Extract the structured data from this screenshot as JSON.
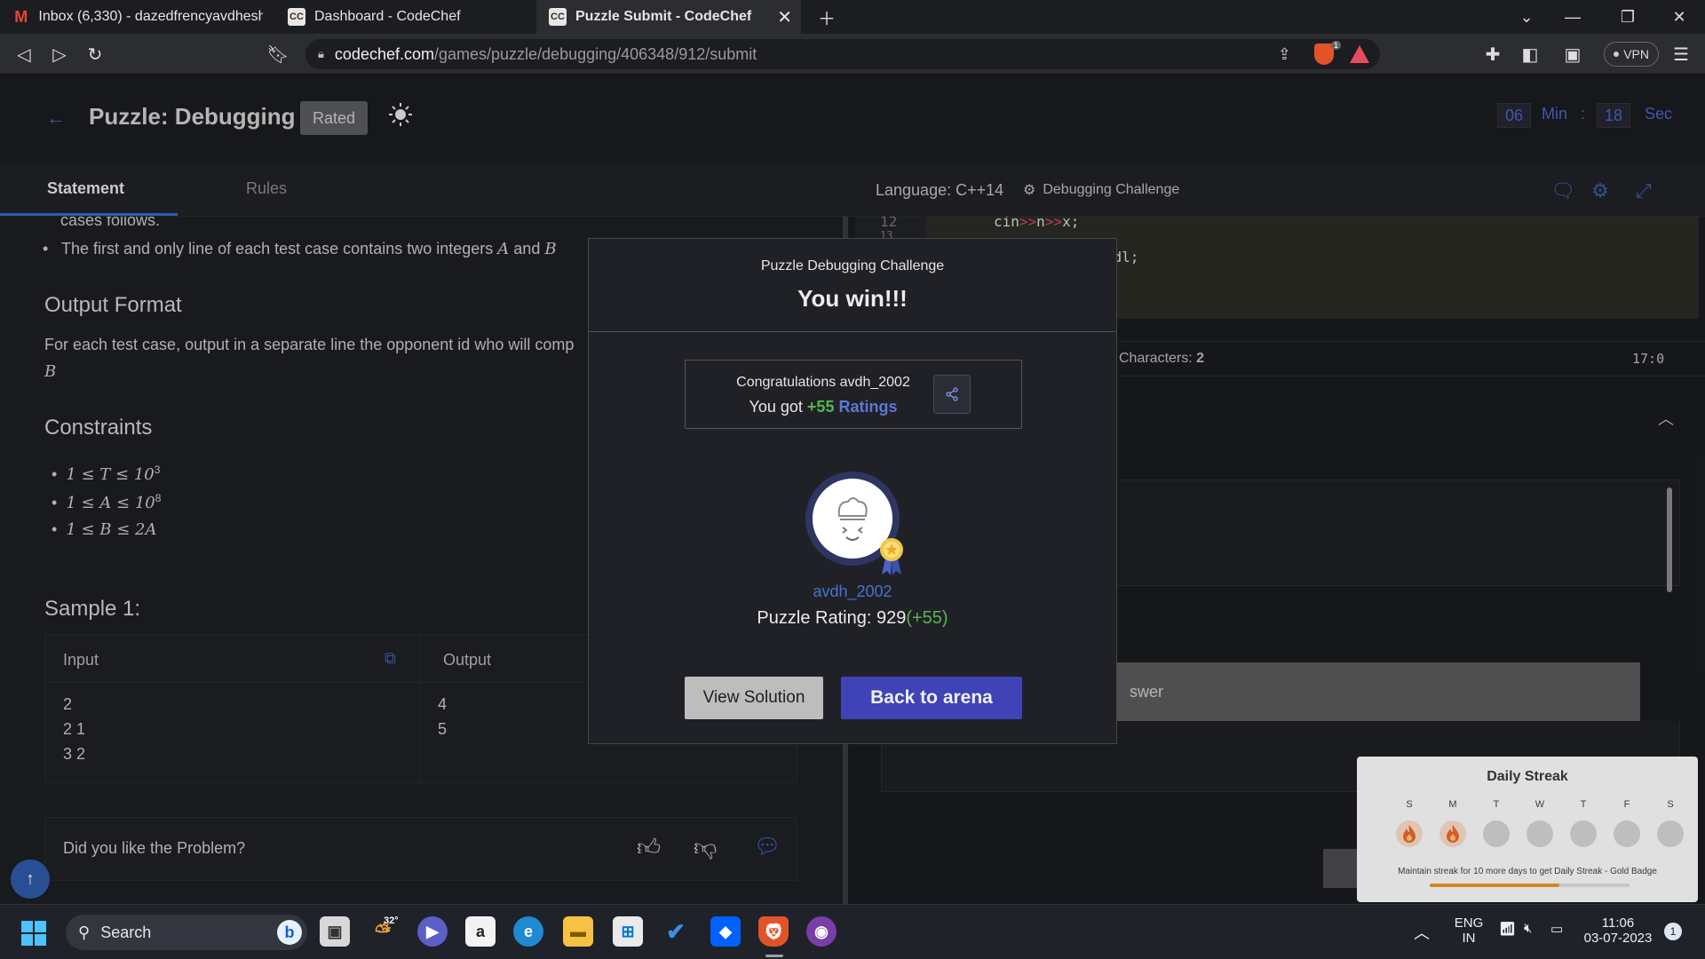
{
  "browser": {
    "tabs": [
      {
        "title": "Inbox (6,330) - dazedfrencyavdhesh@",
        "favicon": "gmail-icon"
      },
      {
        "title": "Dashboard - CodeChef",
        "favicon": "cc"
      },
      {
        "title": "Puzzle Submit - CodeChef",
        "favicon": "cc",
        "active": true
      }
    ],
    "url_host": "codechef.com",
    "url_path": "/games/puzzle/debugging/406348/912/submit",
    "vpn_label": "VPN",
    "shield_count": "1"
  },
  "header": {
    "title": "Puzzle: Debugging",
    "badge": "Rated",
    "timer": {
      "minutes": "06",
      "min_label": "Min",
      "separator": ":",
      "seconds": "18",
      "sec_label": "Sec"
    }
  },
  "tabs": {
    "statement": "Statement",
    "rules": "Rules"
  },
  "editor_bar": {
    "language": "Language: C++14",
    "challenge": "Debugging Challenge"
  },
  "problem": {
    "cut_line": "cases follows.",
    "input_bullet": {
      "text": "The first and only line of each test case contains two integers",
      "var_a": "A",
      "and": "and",
      "var_b": "B"
    },
    "output_heading": "Output Format",
    "output_text": "For each test case, output in a separate line the opponent id who will comp",
    "output_cont": "B",
    "constraints_heading": "Constraints",
    "constraints": [
      {
        "lhs": "1 ≤ ",
        "var": "T",
        "rhs": " ≤ 10",
        "exp": "3"
      },
      {
        "lhs": "1 ≤ ",
        "var": "A",
        "rhs": " ≤ 10",
        "exp": "8"
      },
      {
        "lhs": "1 ≤ ",
        "var": "B",
        "rhs": " ≤ 2",
        "rhs_var": "A",
        "exp": ""
      }
    ],
    "sample_heading": "Sample 1:",
    "sample": {
      "input_label": "Input",
      "output_label": "Output",
      "input_lines": [
        "2",
        "2 1",
        "3 2"
      ],
      "output_lines": [
        "4",
        "5"
      ]
    },
    "feedback": "Did you like the Problem?"
  },
  "editor": {
    "line_numbers": [
      "12",
      "13"
    ],
    "code_line_1": {
      "a": "cin",
      "op1": ">>",
      "b": "n",
      "op2": ">>",
      "c": "x;"
    },
    "code_line_2": {
      "op": "<<",
      "rest": "endl;"
    },
    "characters_label": "Characters:",
    "characters_value": "2",
    "cursor_pos": "17:0",
    "answer_fragment": "swer"
  },
  "modal": {
    "subtitle": "Puzzle Debugging Challenge",
    "title": "You win!!!",
    "congrats": "Congratulations avdh_2002",
    "you_got": "You got",
    "rating_gain": "+55",
    "ratings_word": "Ratings",
    "username": "avdh_2002",
    "puzzle_rating_label": "Puzzle Rating:",
    "puzzle_rating_value": "929",
    "puzzle_rating_delta": "(+55)",
    "view_solution": "View Solution",
    "back_to_arena": "Back to arena"
  },
  "streak": {
    "title": "Daily Streak",
    "days": [
      "S",
      "M",
      "T",
      "W",
      "T",
      "F",
      "S"
    ],
    "lit_days": 2,
    "message": "Maintain streak for 10 more days to get Daily Streak - Gold Badge",
    "progress": 0.65
  },
  "taskbar": {
    "search_placeholder": "Search",
    "weather_temp": "32°",
    "lang_top": "ENG",
    "lang_bottom": "IN",
    "time": "11:06",
    "date": "03-07-2023",
    "notification_count": "1"
  },
  "colors": {
    "accent": "#3f43b5",
    "link": "#4a70d0",
    "positive": "#54b850",
    "streak": "#f29a27"
  }
}
